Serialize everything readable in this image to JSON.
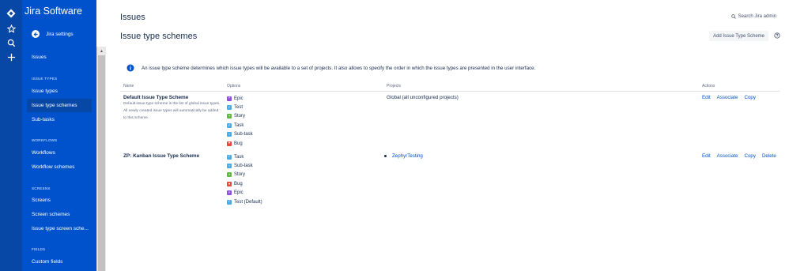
{
  "app": {
    "brand": "Jira Software"
  },
  "rail": {
    "icons": [
      "jira-logo-icon",
      "star-icon",
      "search-icon",
      "create-plus-icon"
    ]
  },
  "sidebar": {
    "back_label": "Jira settings",
    "top_item": "Issues",
    "sections": {
      "issue_types": "ISSUE TYPES",
      "workflows": "WORKFLOWS",
      "screens": "SCREENS",
      "fields": "FIELDS"
    },
    "items": {
      "issue_types": "Issue types",
      "issue_type_schemes": "Issue type schemes",
      "sub_tasks": "Sub-tasks",
      "workflows": "Workflows",
      "workflow_schemes": "Workflow schemes",
      "screens": "Screens",
      "screen_schemes": "Screen schemes",
      "issue_type_screen_schemes": "Issue type screen sche...",
      "custom_fields": "Custom fields"
    },
    "active": "issue_type_schemes"
  },
  "header": {
    "kicker": "Issues",
    "title": "Issue type schemes",
    "search_label": "Search Jira admin",
    "add_button": "Add Issue Type Scheme"
  },
  "info_message": "An issue type scheme determines which issue types will be available to a set of projects. It also allows to specify the order in which the issue types are presented in the user interface.",
  "table": {
    "columns": {
      "name": "Name",
      "options": "Options",
      "projects": "Projects",
      "actions": "Actions"
    },
    "rows": [
      {
        "name": "Default Issue Type Scheme",
        "description": "Default issue type scheme is the list of global issue types. All newly created issue types will automatically be added to this scheme.",
        "options": [
          {
            "label": "Epic",
            "icon": "epic-icon",
            "color": "#904ee2"
          },
          {
            "label": "Test",
            "icon": "test-icon",
            "color": "#4bade8"
          },
          {
            "label": "Story",
            "icon": "story-icon",
            "color": "#63ba3c"
          },
          {
            "label": "Task",
            "icon": "task-icon",
            "color": "#4bade8"
          },
          {
            "label": "Sub-task",
            "icon": "subtask-icon",
            "color": "#4bade8"
          },
          {
            "label": "Bug",
            "icon": "bug-icon",
            "color": "#e5493a"
          }
        ],
        "projects": {
          "text": "Global (all unconfigured projects)"
        },
        "actions": {
          "edit": "Edit",
          "associate": "Associate",
          "copy": "Copy"
        }
      },
      {
        "name": "ZP: Kanban Issue Type Scheme",
        "description": "",
        "options": [
          {
            "label": "Task",
            "icon": "task-icon",
            "color": "#4bade8"
          },
          {
            "label": "Sub-task",
            "icon": "subtask-icon",
            "color": "#4bade8"
          },
          {
            "label": "Story",
            "icon": "story-icon",
            "color": "#63ba3c"
          },
          {
            "label": "Bug",
            "icon": "bug-icon",
            "color": "#e5493a"
          },
          {
            "label": "Epic",
            "icon": "epic-icon",
            "color": "#904ee2"
          },
          {
            "label": "Test (Default)",
            "icon": "test-icon",
            "color": "#4bade8"
          }
        ],
        "projects": {
          "link": "ZephyrTesting"
        },
        "actions": {
          "edit": "Edit",
          "associate": "Associate",
          "copy": "Copy",
          "delete": "Delete"
        }
      }
    ]
  },
  "colors": {
    "rail": "#0747a6",
    "sidebar": "#0052cc",
    "active_item": "#0747a6",
    "link": "#0052cc",
    "text": "#172b4d",
    "muted": "#5e6c84"
  }
}
